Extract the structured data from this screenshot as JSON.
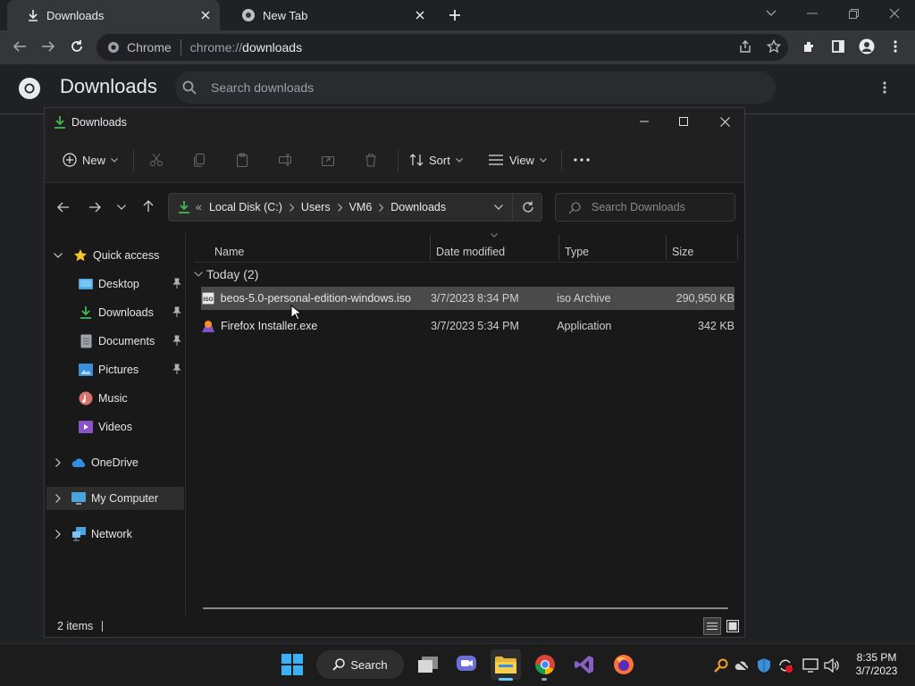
{
  "browser": {
    "tabs": [
      {
        "label": "Downloads",
        "icon": "download-icon",
        "active": true
      },
      {
        "label": "New Tab",
        "icon": "chrome-icon",
        "active": false
      }
    ],
    "omnibox": {
      "site_label": "Chrome",
      "url_prefix": "chrome://",
      "url_path": "downloads"
    }
  },
  "downloads_page": {
    "title": "Downloads",
    "search_placeholder": "Search downloads"
  },
  "explorer": {
    "title": "Downloads",
    "commands": {
      "new": "New",
      "sort": "Sort",
      "view": "View"
    },
    "breadcrumb": {
      "overflow": "«",
      "items": [
        "Local Disk (C:)",
        "Users",
        "VM6",
        "Downloads"
      ]
    },
    "search_placeholder": "Search Downloads",
    "sidebar": {
      "quick_access": "Quick access",
      "items": [
        {
          "label": "Desktop",
          "icon": "desktop-icon",
          "pinned": true
        },
        {
          "label": "Downloads",
          "icon": "download-icon",
          "pinned": true
        },
        {
          "label": "Documents",
          "icon": "documents-icon",
          "pinned": true
        },
        {
          "label": "Pictures",
          "icon": "pictures-icon",
          "pinned": true
        },
        {
          "label": "Music",
          "icon": "music-icon",
          "pinned": false
        },
        {
          "label": "Videos",
          "icon": "videos-icon",
          "pinned": false
        }
      ],
      "onedrive": "OneDrive",
      "my_computer": "My Computer",
      "network": "Network"
    },
    "columns": {
      "name": "Name",
      "date": "Date modified",
      "type": "Type",
      "size": "Size"
    },
    "group_label": "Today (2)",
    "files": [
      {
        "name": "beos-5.0-personal-edition-windows.iso",
        "date": "3/7/2023 8:34 PM",
        "type": "iso Archive",
        "size": "290,950 KB",
        "icon": "iso-file-icon"
      },
      {
        "name": "Firefox Installer.exe",
        "date": "3/7/2023 5:34 PM",
        "type": "Application",
        "size": "342 KB",
        "icon": "firefox-installer-icon"
      }
    ],
    "status": "2 items"
  },
  "taskbar": {
    "search_label": "Search",
    "clock_time": "8:35 PM",
    "clock_date": "3/7/2023"
  },
  "colors": {
    "accent_blue": "#0078d4",
    "selection": "#4a4a4a",
    "folder_green": "#3fb950"
  }
}
